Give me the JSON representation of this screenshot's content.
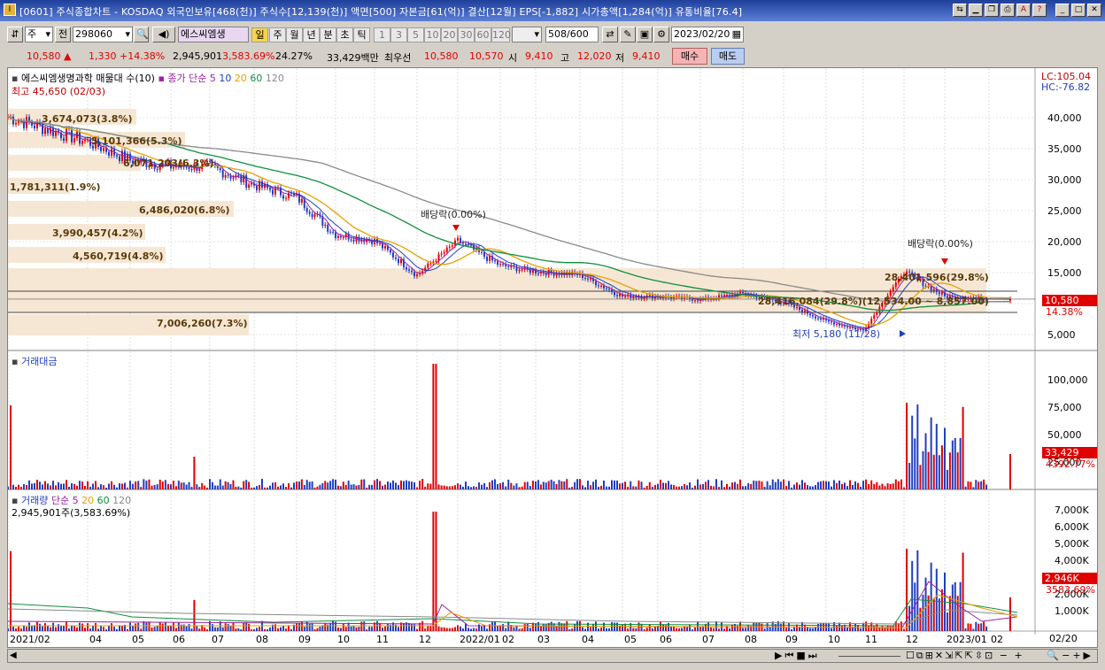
{
  "window": {
    "title": "[0601] 주식종합차트 - KOSDAQ 외국인보유[468(천)] 주식수[12,139(천)] 액면[500] 자본금[61(억)] 결산[12월] EPS[-1,882] 시가총액[1,284(억)] 유통비율[76.4]",
    "icon_label": "I"
  },
  "toolbar": {
    "type_select": "주",
    "market_label": "전",
    "code": "298060",
    "stock_name": "에스씨엠생",
    "periods": [
      "일",
      "주",
      "월",
      "년",
      "분",
      "초",
      "틱"
    ],
    "active_period": "일",
    "intervals": [
      "1",
      "3",
      "5",
      "10",
      "20",
      "30",
      "60",
      "120"
    ],
    "count": "508",
    "count_total": "/600",
    "date": "2023/02/20"
  },
  "quote": {
    "price": "10,580",
    "change": "1,330 +14.38%",
    "volume": "2,945,901",
    "volume_pct": "3,583.69%",
    "turnover": "24.27%",
    "amount": "33,429백만",
    "best_label": "최우선",
    "best_ask": "10,580",
    "best_bid": "10,570",
    "open_label": "시",
    "open": "9,410",
    "high_label": "고",
    "high": "12,020",
    "low_label": "저",
    "low": "9,410",
    "buy": "매수",
    "sell": "매도"
  },
  "price_panel": {
    "legend_name": "에스씨엠생명과학 매물대 수(10)",
    "ma_label": "종가 단순",
    "ma_periods": [
      "5",
      "10",
      "20",
      "60",
      "120"
    ],
    "ma_colors": [
      "#a020a0",
      "#1f3fbf",
      "#e8a000",
      "#0f8f3f",
      "#8a8a8a"
    ],
    "high_note": "최고 45,650 (02/03)",
    "low_note": "최저 5,180 (11/28)",
    "lc": "LC:105.04",
    "hc": "HC:-76.82",
    "current_price": "10,580",
    "current_pct": "14.38%",
    "dividend_notes": [
      "배당락(0.00%)",
      "배당락(0.00%)"
    ],
    "yticks": [
      "40,000",
      "35,000",
      "30,000",
      "25,000",
      "20,000",
      "15,000",
      "10,000",
      "5,000"
    ],
    "volume_profile": [
      "3,674,073(3.8%)",
      "5,101,366(5.3%)",
      "6,071,203(6.3%)",
      "1,781,311(1.9%)",
      "6,486,020(6.8%)",
      "3,990,457(4.2%)",
      "4,560,719(4.8%)",
      "28,401,596(29.8%)",
      "28,416,084(29.8%)(12,534.00 ~ 8,857.00)",
      "7,006,260(7.3%)"
    ]
  },
  "amount_panel": {
    "title": "거래대금",
    "yticks": [
      "100,000",
      "75,000",
      "50,000",
      "25,000"
    ],
    "current": "33,429",
    "current_pct": "4392.77%"
  },
  "volume_panel": {
    "title": "거래량",
    "ma_label": "단순",
    "ma_periods": [
      "5",
      "20",
      "60",
      "120"
    ],
    "current_note": "2,945,901주(3,583.69%)",
    "yticks": [
      "7,000K",
      "6,000K",
      "5,000K",
      "4,000K",
      "3,000K",
      "2,000K",
      "1,000K"
    ],
    "current": "2,946K",
    "current_pct": "3583.69%"
  },
  "xaxis": {
    "ticks": [
      "2021/02",
      "04",
      "05",
      "06",
      "07",
      "08",
      "09",
      "10",
      "11",
      "12",
      "2022/01",
      "02",
      "03",
      "04",
      "05",
      "06",
      "07",
      "08",
      "09",
      "10",
      "11",
      "12",
      "2023/01",
      "02"
    ],
    "right_label": "02/20"
  },
  "chart_data": {
    "type": "line",
    "title": "에스씨엠생명과학 매물대 수(10)",
    "x": [
      "2021/02",
      "2021/04",
      "2021/05",
      "2021/06",
      "2021/07",
      "2021/08",
      "2021/09",
      "2021/10",
      "2021/11",
      "2021/12",
      "2022/01",
      "2022/02",
      "2022/03",
      "2022/04",
      "2022/05",
      "2022/06",
      "2022/07",
      "2022/08",
      "2022/09",
      "2022/10",
      "2022/11",
      "2022/12",
      "2023/01",
      "2023/02"
    ],
    "series": [
      {
        "name": "종가",
        "values": [
          40000,
          36000,
          33000,
          32000,
          32000,
          29000,
          27000,
          21000,
          20000,
          14500,
          20000,
          16000,
          15000,
          14500,
          11000,
          11000,
          10500,
          11500,
          10000,
          7000,
          5500,
          15000,
          11000,
          10580
        ]
      }
    ],
    "ylim": [
      3000,
      46000
    ],
    "annotations": [
      "최고 45,650 (02/03)",
      "최저 5,180 (11/28)"
    ]
  }
}
